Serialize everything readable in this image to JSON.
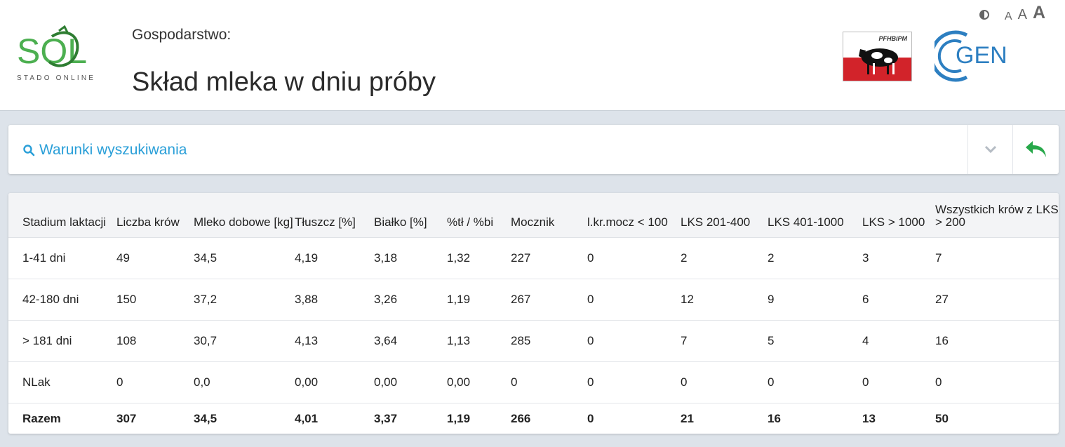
{
  "header": {
    "logo_text": "SOL",
    "logo_sub": "STADO ONLINE",
    "farm_label": "Gospodarstwo:",
    "page_title": "Skład mleka w dniu próby",
    "pfhb_text": "PFHBiPM",
    "cgen_text": "GEN"
  },
  "accessibility": {
    "a_small": "A",
    "a_medium": "A",
    "a_large": "A"
  },
  "search": {
    "title": "Warunki wyszukiwania"
  },
  "colors": {
    "accent": "#2a9fd8",
    "green": "#27a84a",
    "logo_green": "#4caf50",
    "cgen_blue": "#2d7fc1",
    "pfhb_red": "#d2232a"
  },
  "table": {
    "headers": [
      "Stadium laktacji",
      "Liczba krów",
      "Mleko dobowe [kg]",
      "Tłuszcz [%]",
      "Białko [%]",
      "%tł / %bi",
      "Mocznik",
      "l.kr.mocz < 100",
      "LKS 201-400",
      "LKS 401-1000",
      "LKS > 1000",
      "Wszystkich krów z LKS > 200"
    ],
    "rows": [
      [
        "1-41 dni",
        "49",
        "34,5",
        "4,19",
        "3,18",
        "1,32",
        "227",
        "0",
        "2",
        "2",
        "3",
        "7"
      ],
      [
        "42-180 dni",
        "150",
        "37,2",
        "3,88",
        "3,26",
        "1,19",
        "267",
        "0",
        "12",
        "9",
        "6",
        "27"
      ],
      [
        "> 181 dni",
        "108",
        "30,7",
        "4,13",
        "3,64",
        "1,13",
        "285",
        "0",
        "7",
        "5",
        "4",
        "16"
      ],
      [
        "NLak",
        "0",
        "0,0",
        "0,00",
        "0,00",
        "0,00",
        "0",
        "0",
        "0",
        "0",
        "0",
        "0"
      ]
    ],
    "total": [
      "Razem",
      "307",
      "34,5",
      "4,01",
      "3,37",
      "1,19",
      "266",
      "0",
      "21",
      "16",
      "13",
      "50"
    ]
  }
}
